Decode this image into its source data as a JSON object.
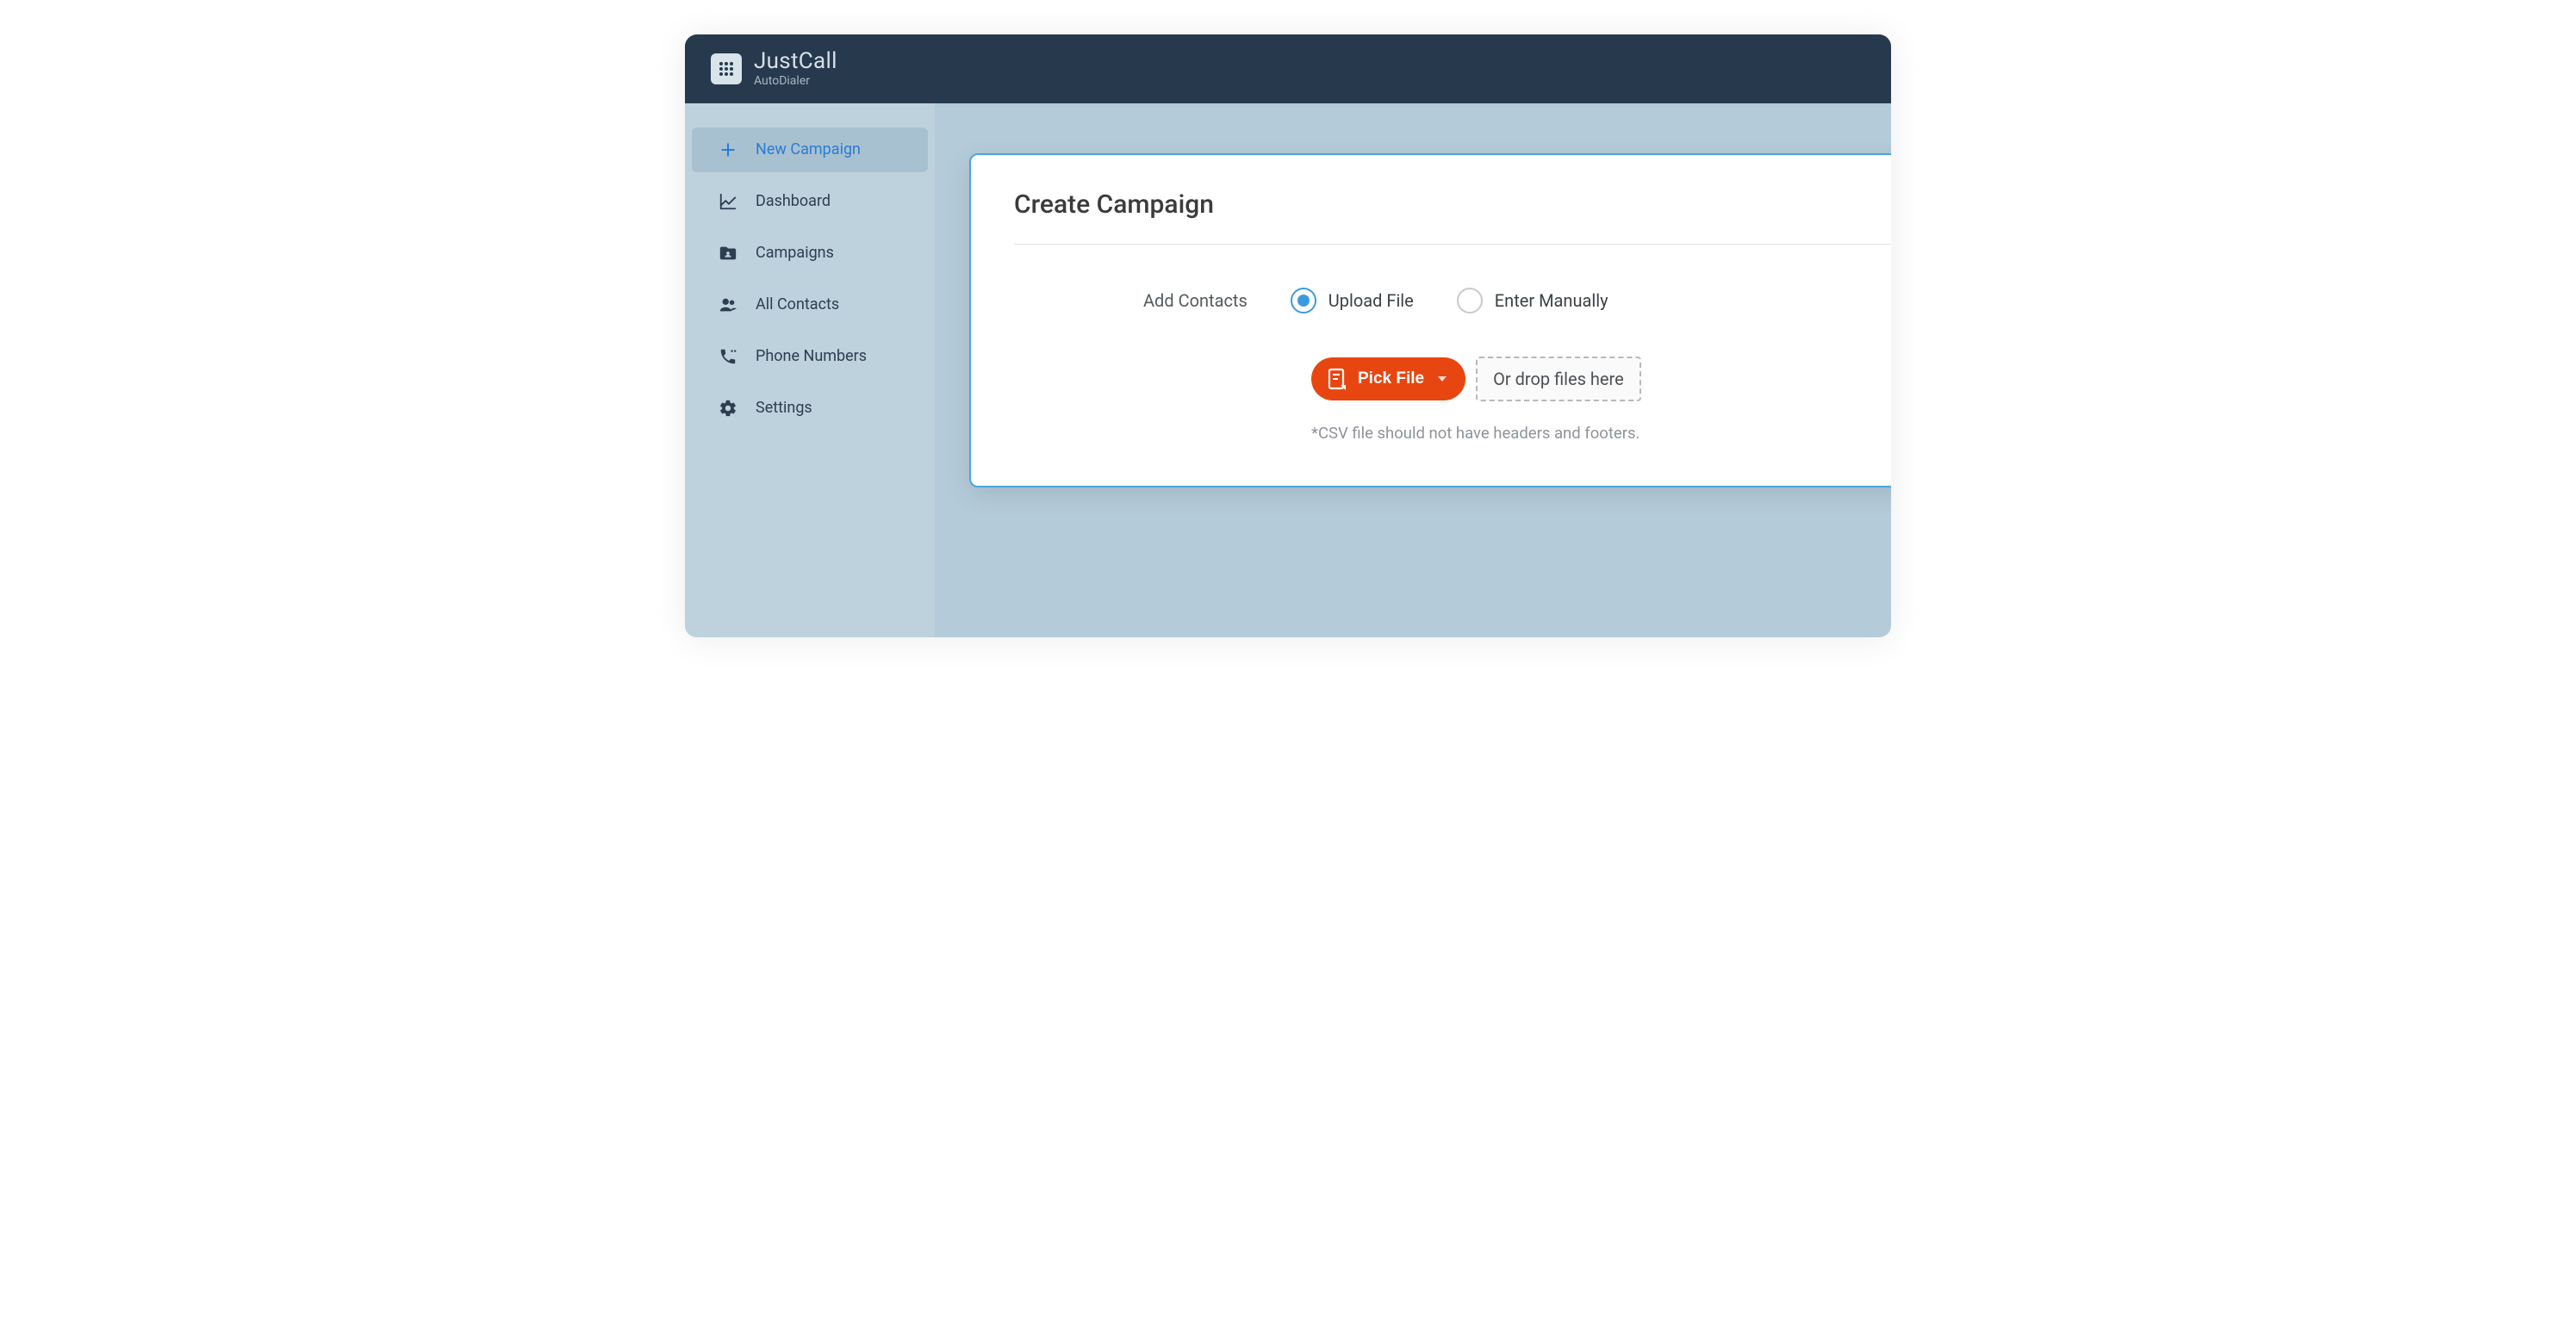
{
  "brand": {
    "main": "JustCall",
    "sub": "AutoDialer"
  },
  "sidebar": {
    "items": [
      {
        "icon": "plus",
        "label": "New Campaign",
        "active": true
      },
      {
        "icon": "chart",
        "label": "Dashboard",
        "active": false
      },
      {
        "icon": "folder-person",
        "label": "Campaigns",
        "active": false
      },
      {
        "icon": "people",
        "label": "All Contacts",
        "active": false
      },
      {
        "icon": "phone",
        "label": "Phone Numbers",
        "active": false
      },
      {
        "icon": "gear",
        "label": "Settings",
        "active": false
      }
    ]
  },
  "main": {
    "title": "Create Campaign",
    "add_contacts_label": "Add Contacts",
    "options": {
      "upload": "Upload File",
      "manual": "Enter Manually"
    },
    "pick_file_label": "Pick File",
    "drop_label": "Or drop files here",
    "hint": "*CSV file should not have headers and footers."
  },
  "colors": {
    "accent_orange": "#e84610",
    "accent_blue": "#3a9ce0",
    "header_bg": "#26394d",
    "body_bg": "#b4cbd9",
    "sidebar_bg": "#bed2de"
  }
}
